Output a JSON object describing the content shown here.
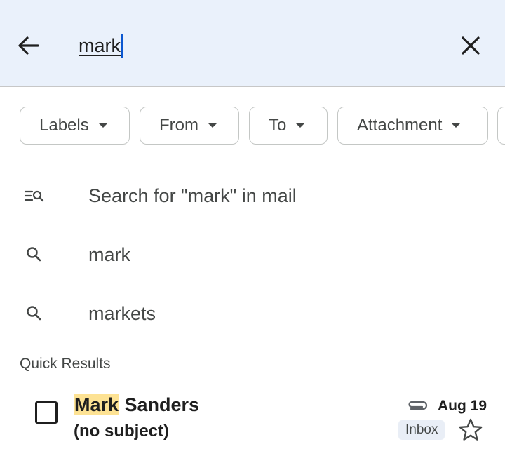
{
  "search": {
    "query": "mark",
    "icons": {
      "back": "arrow-back-icon",
      "clear": "close-icon"
    }
  },
  "filters": [
    {
      "label": "Labels"
    },
    {
      "label": "From"
    },
    {
      "label": "To"
    },
    {
      "label": "Attachment"
    }
  ],
  "suggestions": [
    {
      "text": "Search for \"mark\" in mail",
      "icon": "search-in-mail-icon"
    },
    {
      "text": "mark",
      "icon": "search-icon"
    },
    {
      "text": "markets",
      "icon": "search-icon"
    }
  ],
  "quick_results": {
    "title": "Quick Results",
    "items": [
      {
        "sender_match": "Mark",
        "sender_rest": " Sanders",
        "subject": "(no subject)",
        "date": "Aug 19",
        "label": "Inbox",
        "has_attachment": true,
        "starred": false
      }
    ]
  },
  "colors": {
    "header_bg": "#eaf1fb",
    "caret": "#0b57d0",
    "highlight": "#fde293",
    "badge_bg": "#e9eef6"
  }
}
